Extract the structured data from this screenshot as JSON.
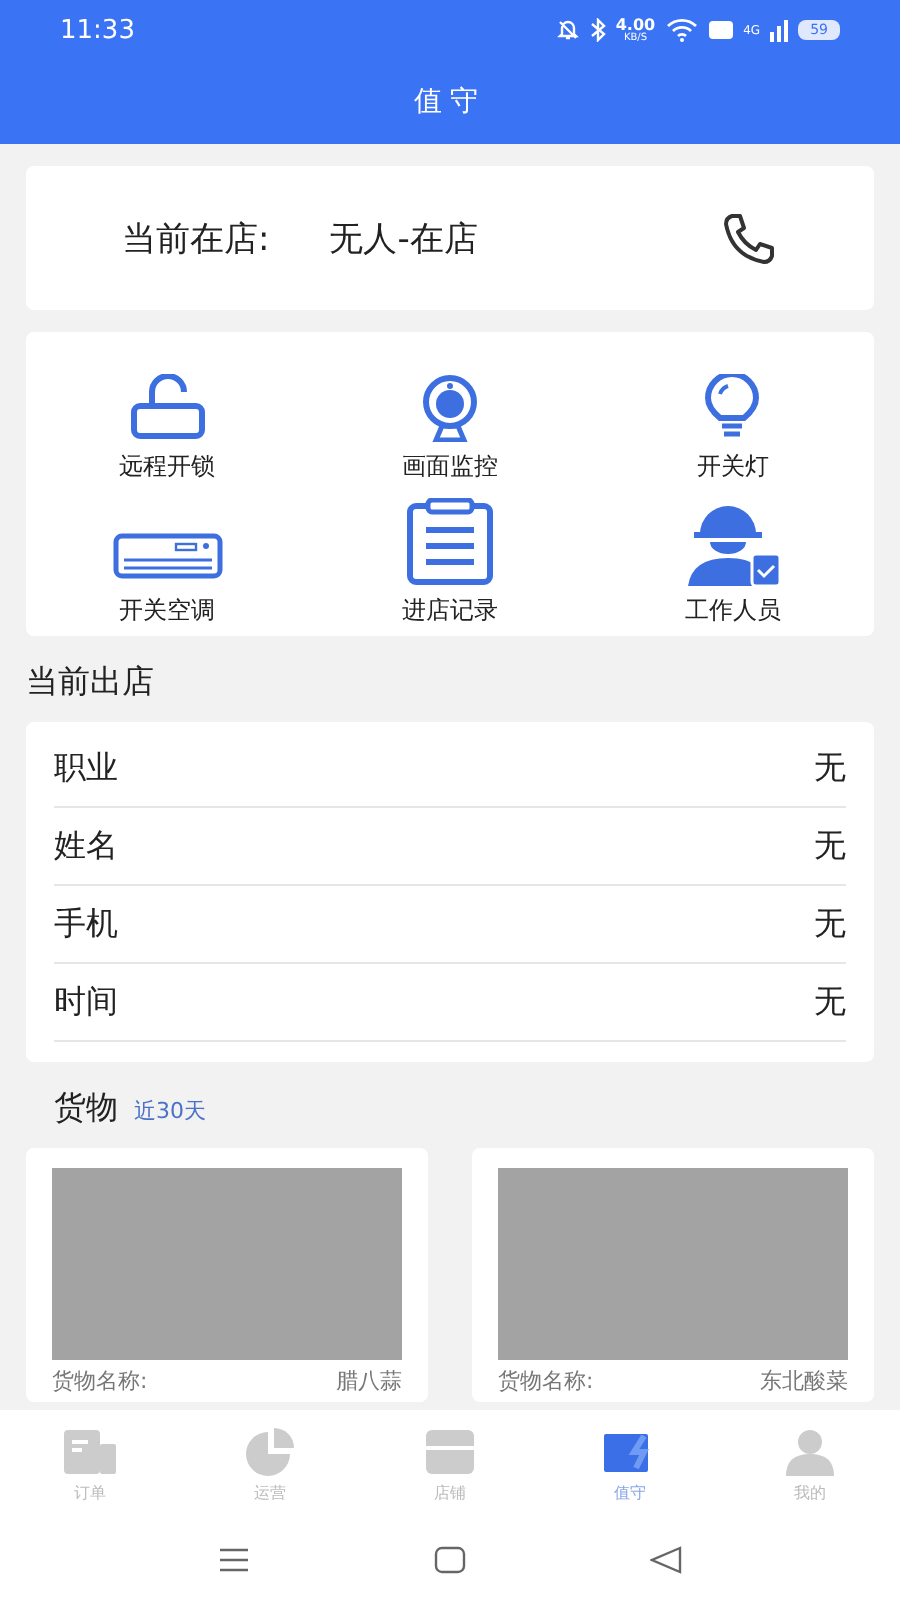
{
  "status_bar": {
    "time": "11:33",
    "speed": "4.00",
    "speed_unit": "KB/S",
    "network": "4G",
    "battery": "59"
  },
  "header": {
    "title": "值守"
  },
  "presence": {
    "label": "当前在店:",
    "value": "无人-在店"
  },
  "actions": [
    {
      "kind": "unlock",
      "label": "远程开锁"
    },
    {
      "kind": "camera",
      "label": "画面监控"
    },
    {
      "kind": "light",
      "label": "开关灯"
    },
    {
      "kind": "aircon",
      "label": "开关空调"
    },
    {
      "kind": "log",
      "label": "进店记录"
    },
    {
      "kind": "staff",
      "label": "工作人员"
    }
  ],
  "exit_section": {
    "title": "当前出店",
    "rows": [
      {
        "label": "职业",
        "value": "无"
      },
      {
        "label": "姓名",
        "value": "无"
      },
      {
        "label": "手机",
        "value": "无"
      },
      {
        "label": "时间",
        "value": "无"
      }
    ]
  },
  "goods": {
    "title": "货物",
    "range": "近30天",
    "items": [
      {
        "name_label": "货物名称:",
        "name": "腊八蒜"
      },
      {
        "name_label": "货物名称:",
        "name": "东北酸菜"
      }
    ]
  },
  "tabs": [
    {
      "kind": "orders",
      "label": "订单",
      "selected": false
    },
    {
      "kind": "ops",
      "label": "运营",
      "selected": false
    },
    {
      "kind": "shop",
      "label": "店铺",
      "selected": false
    },
    {
      "kind": "duty",
      "label": "值守",
      "selected": true
    },
    {
      "kind": "me",
      "label": "我的",
      "selected": false
    }
  ]
}
